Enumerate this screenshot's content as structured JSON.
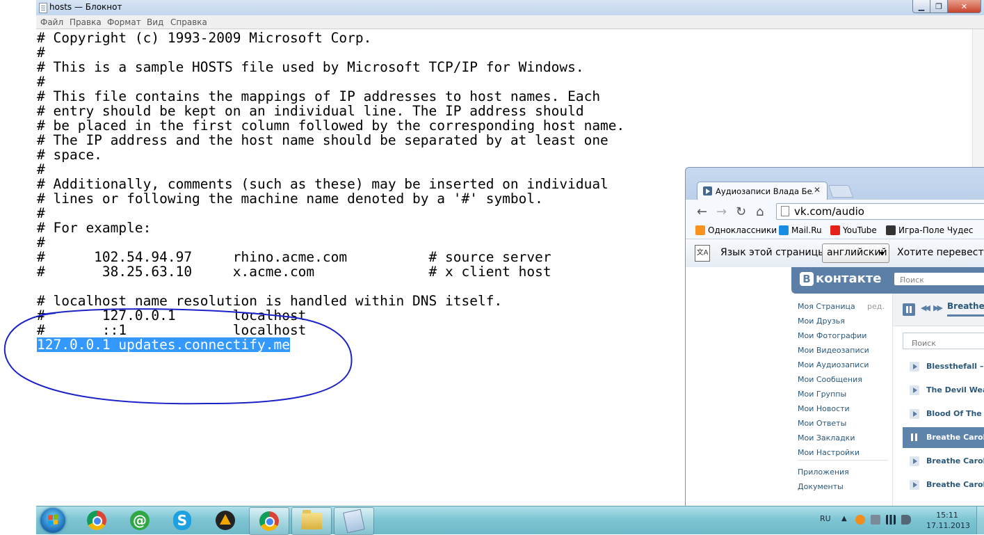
{
  "notepad": {
    "title": "hosts — Блокнот",
    "menu": [
      "Файл",
      "Правка",
      "Формат",
      "Вид",
      "Справка"
    ],
    "lines": [
      "# Copyright (c) 1993-2009 Microsoft Corp.",
      "#",
      "# This is a sample HOSTS file used by Microsoft TCP/IP for Windows.",
      "#",
      "# This file contains the mappings of IP addresses to host names. Each",
      "# entry should be kept on an individual line. The IP address should",
      "# be placed in the first column followed by the corresponding host name.",
      "# The IP address and the host name should be separated by at least one",
      "# space.",
      "#",
      "# Additionally, comments (such as these) may be inserted on individual",
      "# lines or following the machine name denoted by a '#' symbol.",
      "#",
      "# For example:",
      "#",
      "#      102.54.94.97     rhino.acme.com          # source server",
      "#       38.25.63.10     x.acme.com              # x client host",
      "",
      "# localhost name resolution is handled within DNS itself.",
      "#       127.0.0.1       localhost",
      "#       ::1             localhost",
      "127.0.0.1 updates.connectify.me"
    ],
    "selected_line": "127.0.0.1 updates.connectify.me",
    "annotation_color": "#1a22c8"
  },
  "browser": {
    "tab_title": "Аудиозаписи Влада Беля",
    "url": "vk.com/audio",
    "bookmarks": [
      {
        "label": "Одноклассники",
        "color": "#f7931e"
      },
      {
        "label": "Mail.Ru",
        "color": "#168de2"
      },
      {
        "label": "YouTube",
        "color": "#e62117"
      },
      {
        "label": "Игра-Поле Чудес",
        "color": "#333333"
      }
    ],
    "translate": {
      "label": "Язык этой страницы",
      "language": "английский",
      "question": "Хотите перевести"
    },
    "vk": {
      "logo_text": "контакте",
      "logo_letter": "В",
      "search_placeholder": "Поиск",
      "menu_edit": "ред.",
      "menu": [
        "Моя Страница",
        "Мои Друзья",
        "Мои Фотографии",
        "Мои Видеозаписи",
        "Мои Аудиозаписи",
        "Мои Сообщения",
        "Мои Группы",
        "Мои Новости",
        "Мои Ответы",
        "Мои Закладки",
        "Мои Настройки"
      ],
      "menu_extra": [
        "Приложения",
        "Документы"
      ],
      "now_playing": "Breathe",
      "audio_search_placeholder": "Поиск",
      "tracks": [
        "Blessthefall – Yo",
        "The Devil Wear",
        "Blood Of The M",
        "Breathe Carolin",
        "Breathe Carolin",
        "Breathe Carolin"
      ],
      "active_track_index": 3,
      "accent": "#5b7fa6"
    }
  },
  "taskbar": {
    "language": "RU",
    "time": "15:11",
    "date": "17.11.2013"
  }
}
